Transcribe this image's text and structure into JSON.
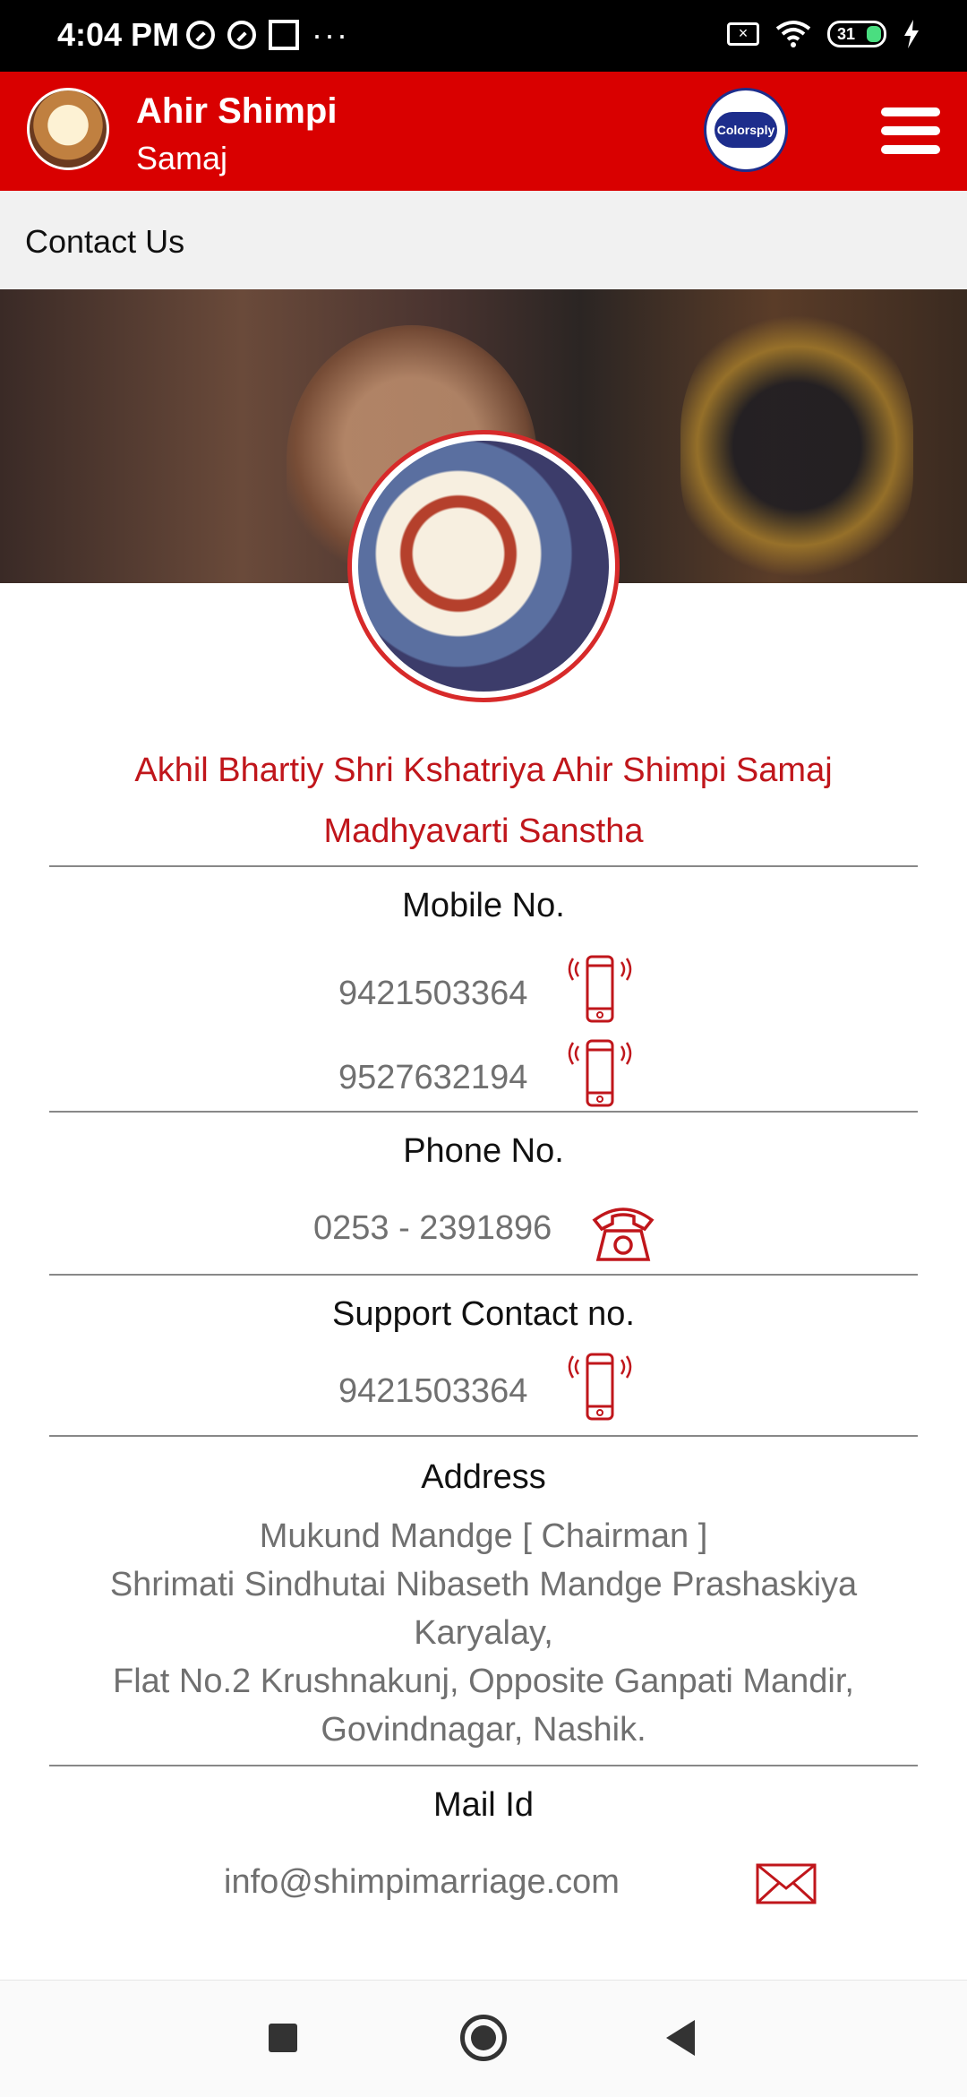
{
  "status_bar": {
    "time": "4:04 PM",
    "battery": "31"
  },
  "app_bar": {
    "title": "Ahir Shimpi",
    "subtitle": "Samaj",
    "brand_logo_text": "Colorsply"
  },
  "page": {
    "title": "Contact Us"
  },
  "organization": {
    "name_line1": "Akhil Bhartiy Shri Kshatriya Ahir Shimpi Samaj",
    "name_line2": "Madhyavarti Sanstha"
  },
  "sections": {
    "mobile": {
      "title": "Mobile No.",
      "numbers": [
        "9421503364",
        "9527632194"
      ]
    },
    "phone": {
      "title": "Phone No.",
      "number": "0253 - 2391896"
    },
    "support": {
      "title": "Support Contact no.",
      "number": "9421503364"
    },
    "address": {
      "title": "Address",
      "lines": [
        "Mukund Mandge [ Chairman ]",
        "Shrimati Sindhutai Nibaseth Mandge Prashaskiya",
        "Karyalay,",
        "Flat No.2 Krushnakunj, Opposite Ganpati Mandir,",
        "Govindnagar, Nashik."
      ]
    },
    "mail": {
      "title": "Mail Id",
      "email": "info@shimpimarriage.com"
    }
  },
  "colors": {
    "app_bar": "#d90000",
    "accent_red": "#c0161b",
    "value_gray": "#707070"
  },
  "icons": [
    "mobile-phone-icon",
    "telephone-icon",
    "mail-icon",
    "menu-icon",
    "recent-apps-icon",
    "home-icon",
    "back-icon"
  ]
}
